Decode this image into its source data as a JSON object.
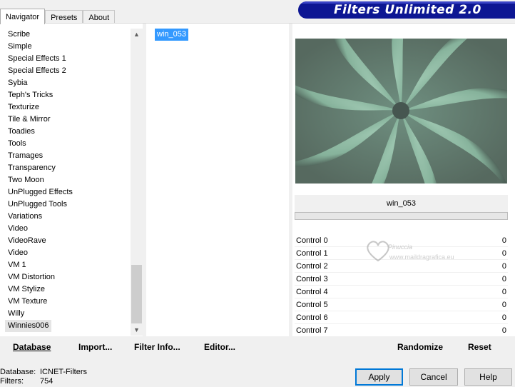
{
  "tabs": [
    {
      "label": "Navigator",
      "active": true
    },
    {
      "label": "Presets",
      "active": false
    },
    {
      "label": "About",
      "active": false
    }
  ],
  "banner": {
    "title": "Filters Unlimited 2.0"
  },
  "categories": [
    "Scribe",
    "Simple",
    "Special Effects 1",
    "Special Effects 2",
    "Sybia",
    "Teph's Tricks",
    "Texturize",
    "Tile & Mirror",
    "Toadies",
    "Tools",
    "Tramages",
    "Transparency",
    "Two Moon",
    "UnPlugged Effects",
    "UnPlugged Tools",
    "Variations",
    "Video",
    "VideoRave",
    "Video",
    "VM 1",
    "VM Distortion",
    "VM Stylize",
    "VM Texture",
    "Willy",
    "Winnies006"
  ],
  "selected_category": "Winnies006",
  "filters": [
    "win_053"
  ],
  "selected_filter": "win_053",
  "preview": {
    "filter_name": "win_053"
  },
  "controls": [
    {
      "label": "Control 0",
      "value": "0"
    },
    {
      "label": "Control 1",
      "value": "0"
    },
    {
      "label": "Control 2",
      "value": "0"
    },
    {
      "label": "Control 3",
      "value": "0"
    },
    {
      "label": "Control 4",
      "value": "0"
    },
    {
      "label": "Control 5",
      "value": "0"
    },
    {
      "label": "Control 6",
      "value": "0"
    },
    {
      "label": "Control 7",
      "value": "0"
    }
  ],
  "watermark": {
    "title": "Pinuccia",
    "url": "www.maildragrafica.eu"
  },
  "toolbar": {
    "database": "Database",
    "import": "Import...",
    "filter_info": "Filter Info...",
    "editor": "Editor...",
    "randomize": "Randomize",
    "reset": "Reset"
  },
  "status": {
    "database_label": "Database:",
    "database_value": "ICNET-Filters",
    "filters_label": "Filters:",
    "filters_value": "754"
  },
  "buttons": {
    "apply": "Apply",
    "cancel": "Cancel",
    "help": "Help"
  },
  "colors": {
    "banner": "#0d1693",
    "selection": "#3399ff",
    "preview_light": "#8fb9a3",
    "preview_dark": "#3f4a45"
  }
}
